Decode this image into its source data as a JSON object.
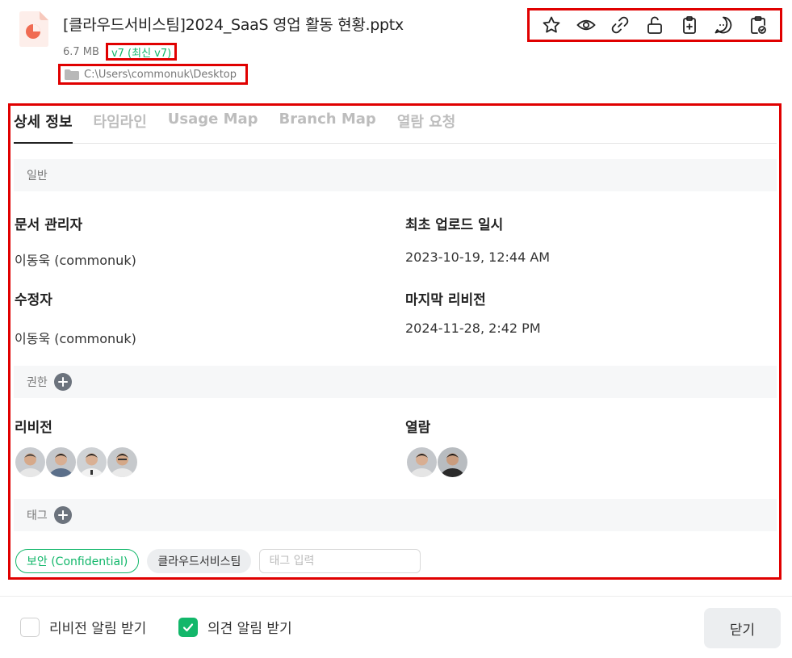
{
  "file": {
    "title": "[클라우드서비스팀]2024_SaaS 영업 활동 현황.pptx",
    "size": "6.7 MB",
    "version": "v7 (최신 v7)",
    "path": "C:\\Users\\commonuk\\Desktop",
    "icon": "powerpoint-file-icon"
  },
  "toolbar": {
    "icons": [
      "star-icon",
      "eye-icon",
      "link-icon",
      "unlock-icon",
      "clipboard-plus-icon",
      "comment-icon",
      "clipboard-check-icon"
    ]
  },
  "tabs": [
    {
      "label": "상세 정보",
      "active": true
    },
    {
      "label": "타임라인",
      "active": false
    },
    {
      "label": "Usage Map",
      "active": false
    },
    {
      "label": "Branch Map",
      "active": false
    },
    {
      "label": "열람 요청",
      "active": false
    }
  ],
  "sections": {
    "general": "일반",
    "permission": "권한",
    "tag": "태그"
  },
  "fields": {
    "manager_label": "문서 관리자",
    "manager_value": "이동욱 (commonuk)",
    "first_upload_label": "최초 업로드 일시",
    "first_upload_value": "2023-10-19, 12:44 AM",
    "editor_label": "수정자",
    "editor_value": "이동욱 (commonuk)",
    "last_revision_label": "마지막 리비전",
    "last_revision_value": "2024-11-28, 2:42 PM",
    "revision_label": "리비전",
    "view_label": "열람"
  },
  "tags": [
    "보안 (Confidential)",
    "클라우드서비스팀"
  ],
  "tag_input": {
    "placeholder": "태그 입력",
    "value": ""
  },
  "footer": {
    "revision_alert": "리비전 알림 받기",
    "revision_alert_checked": false,
    "comment_alert": "의견 알림 받기",
    "comment_alert_checked": true,
    "close_label": "닫기"
  },
  "colors": {
    "accent": "#12b76a",
    "highlight": "#e00000",
    "file_icon": "#f06b52"
  }
}
